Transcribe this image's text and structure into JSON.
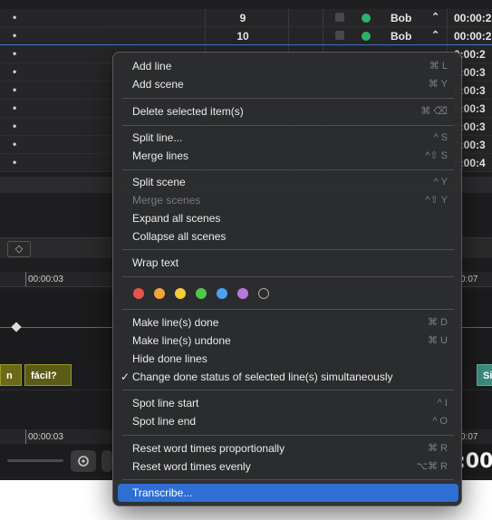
{
  "table": {
    "rows": [
      {
        "dot": "•",
        "num": "9",
        "character": "Bob",
        "time": "00:00:2"
      },
      {
        "dot": "•",
        "num": "10",
        "character": "Bob",
        "time": "00:00:2"
      },
      {
        "dot": "•",
        "num": "",
        "character": "",
        "time": "0:00:2"
      },
      {
        "dot": "•",
        "num": "",
        "character": "",
        "time": "0:00:3"
      },
      {
        "dot": "•",
        "num": "",
        "character": "",
        "time": "0:00:3"
      },
      {
        "dot": "•",
        "num": "",
        "character": "",
        "time": "0:00:3"
      },
      {
        "dot": "•",
        "num": "",
        "character": "",
        "time": "0:00:3"
      },
      {
        "dot": "•",
        "num": "",
        "character": "",
        "time": "0:00:3"
      },
      {
        "dot": "•",
        "num": "",
        "character": "",
        "time": "0:00:4"
      }
    ],
    "stepper_glyph": "⌃",
    "status_color": "#2fb26a"
  },
  "timeline": {
    "ruler_left": "00:00:03",
    "ruler_right": "0:07",
    "clip_a": "n",
    "clip_b": "fácil?",
    "clip_c": "Si",
    "ruler2_left": "00:00:03",
    "ruler2_right": "0:07",
    "big_time": ":00",
    "stepper_glyph": "◇"
  },
  "menu": {
    "add_line": {
      "label": "Add line",
      "shortcut": "⌘ L"
    },
    "add_scene": {
      "label": "Add scene",
      "shortcut": "⌘ Y"
    },
    "delete_selected": {
      "label": "Delete selected item(s)",
      "shortcut": "⌘ ⌫"
    },
    "split_line": {
      "label": "Split line...",
      "shortcut": "^ S"
    },
    "merge_lines": {
      "label": "Merge lines",
      "shortcut": "^⇧ S"
    },
    "split_scene": {
      "label": "Split scene",
      "shortcut": "^ Y"
    },
    "merge_scenes": {
      "label": "Merge scenes",
      "shortcut": "^⇧ Y"
    },
    "expand_all": {
      "label": "Expand all scenes"
    },
    "collapse_all": {
      "label": "Collapse all scenes"
    },
    "wrap_text": {
      "label": "Wrap text"
    },
    "colors": [
      "#e5534b",
      "#f2a33c",
      "#f4cd3a",
      "#4ec84f",
      "#4aa3f0",
      "#b779e0"
    ],
    "make_done": {
      "label": "Make line(s) done",
      "shortcut": "⌘ D"
    },
    "make_undone": {
      "label": "Make line(s) undone",
      "shortcut": "⌘ U"
    },
    "hide_done": {
      "label": "Hide done lines"
    },
    "change_done_status": {
      "label": "Change done status of selected line(s) simultaneously",
      "check": "✓"
    },
    "spot_start": {
      "label": "Spot line start",
      "shortcut": "^ I"
    },
    "spot_end": {
      "label": "Spot line end",
      "shortcut": "^ O"
    },
    "reset_prop": {
      "label": "Reset word times proportionally",
      "shortcut": "⌘ R"
    },
    "reset_even": {
      "label": "Reset word times evenly",
      "shortcut": "⌥⌘ R"
    },
    "transcribe": {
      "label": "Transcribe..."
    }
  }
}
